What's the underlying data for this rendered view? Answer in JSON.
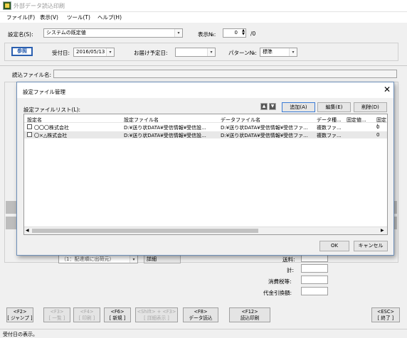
{
  "window": {
    "title": "外部データ読込印刷",
    "icon_text": "■"
  },
  "menu": [
    "ファイル(F)",
    "表示(V)",
    "ツール(T)",
    "ヘルプ(H)"
  ],
  "settings": {
    "name_label": "設定名(S):",
    "name_value": "システムの既定値",
    "display_no_label": "表示№:",
    "display_no_value": "0",
    "display_no_total": "/0",
    "browse_button": "参照",
    "received_label": "受付日:",
    "received_value": "2016/05/13",
    "delivery_label": "お届け予定日:",
    "delivery_value": "",
    "pattern_label": "パターン№:",
    "pattern_value": "標準",
    "file_label": "読込ファイル名:"
  },
  "background": {
    "sort_value": "（1：配達順に出荷元）",
    "detail_button": "詳細",
    "totals": [
      {
        "label": "送料:"
      },
      {
        "label": "計:"
      },
      {
        "label": "消費税等:"
      },
      {
        "label": "代金引換額:"
      }
    ]
  },
  "dialog": {
    "title": "設定ファイル管理",
    "list_label": "設定ファイルリスト(L):",
    "add_button": "追加(A)",
    "edit_button": "編集(E)",
    "delete_button": "削除(D)",
    "ok_button": "OK",
    "cancel_button": "キャンセル",
    "columns": [
      "設定名",
      "設定ファイル名",
      "データファイル名",
      "データ種...",
      "固定値...",
      "固定("
    ],
    "rows": [
      {
        "name": "〇〇〇株式会社",
        "settings_file": "D:¥送り状DATA¥受信情報¥受信設...",
        "data_file": "D:¥送り状DATA¥受信情報¥受信ファ...",
        "data_kind": "複数ファ...",
        "fixed1": "",
        "fixed2": "0"
      },
      {
        "name": "〇×△株式会社",
        "settings_file": "D:¥送り状DATA¥受信情報¥受信設...",
        "data_file": "D:¥送り状DATA¥受信情報¥受信ファ...",
        "data_kind": "複数ファ...",
        "fixed1": "",
        "fixed2": "0"
      }
    ]
  },
  "function_keys": [
    {
      "key": "<F2>",
      "label": "[ ジャンプ ]",
      "enabled": true
    },
    {
      "key": "<F3>",
      "label": "[ 一覧 ]",
      "enabled": false
    },
    {
      "key": "<F4>",
      "label": "[ 印刷 ]",
      "enabled": false
    },
    {
      "key": "<F6>",
      "label": "[ 新規 ]",
      "enabled": true
    },
    {
      "key": "<Shift> + <F3>",
      "label": "[ 詳細表示 ]",
      "enabled": false
    },
    {
      "key": "<F8>",
      "label": "データ読込",
      "enabled": true
    },
    {
      "key": "<F12>",
      "label": "読込印刷",
      "enabled": true
    },
    {
      "key": "<ESC>",
      "label": "[ 終了 ]",
      "enabled": true
    }
  ],
  "status": "受付日の表示。"
}
